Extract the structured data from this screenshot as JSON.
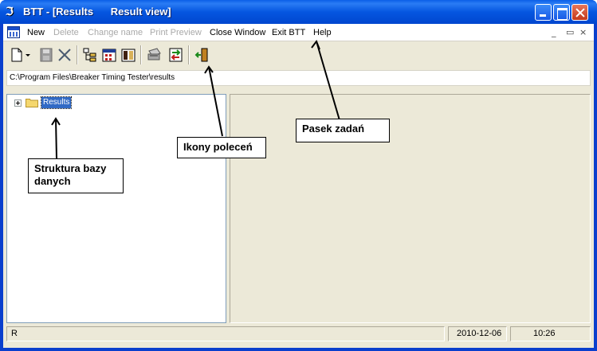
{
  "window": {
    "title": "BTT - [Results      Result view]"
  },
  "menu": {
    "items": [
      {
        "label": "New",
        "enabled": true
      },
      {
        "label": "Delete",
        "enabled": false
      },
      {
        "label": "Change name",
        "enabled": false
      },
      {
        "label": "Print Preview",
        "enabled": false
      },
      {
        "label": "Close Window",
        "enabled": true
      },
      {
        "label": "Exit BTT",
        "enabled": true
      },
      {
        "label": "Help",
        "enabled": true
      }
    ],
    "mdi_controls": [
      "_",
      "▭",
      "×"
    ]
  },
  "toolbar": {
    "icons": [
      "new-document-icon",
      "dropdown-arrow-icon",
      "save-icon",
      "delete-icon",
      "tree-view-icon",
      "calendar-icon",
      "columns-icon",
      "print-icon",
      "export-icon",
      "exit-door-icon"
    ]
  },
  "path": {
    "value": "C:\\Program Files\\Breaker Timing Tester\\results"
  },
  "tree": {
    "root_label": "Results"
  },
  "status": {
    "main": "R",
    "date": "2010-12-06",
    "time": "10:26"
  },
  "annotations": {
    "taskbar": "Pasek zadań",
    "commands": "Ikony poleceń",
    "db_structure_line1": "Struktura bazy",
    "db_structure_line2": "danych"
  },
  "colors": {
    "titlebar": "#0556e0",
    "selection": "#316ac5",
    "client": "#ece9d8",
    "close_button": "#c4391c"
  }
}
